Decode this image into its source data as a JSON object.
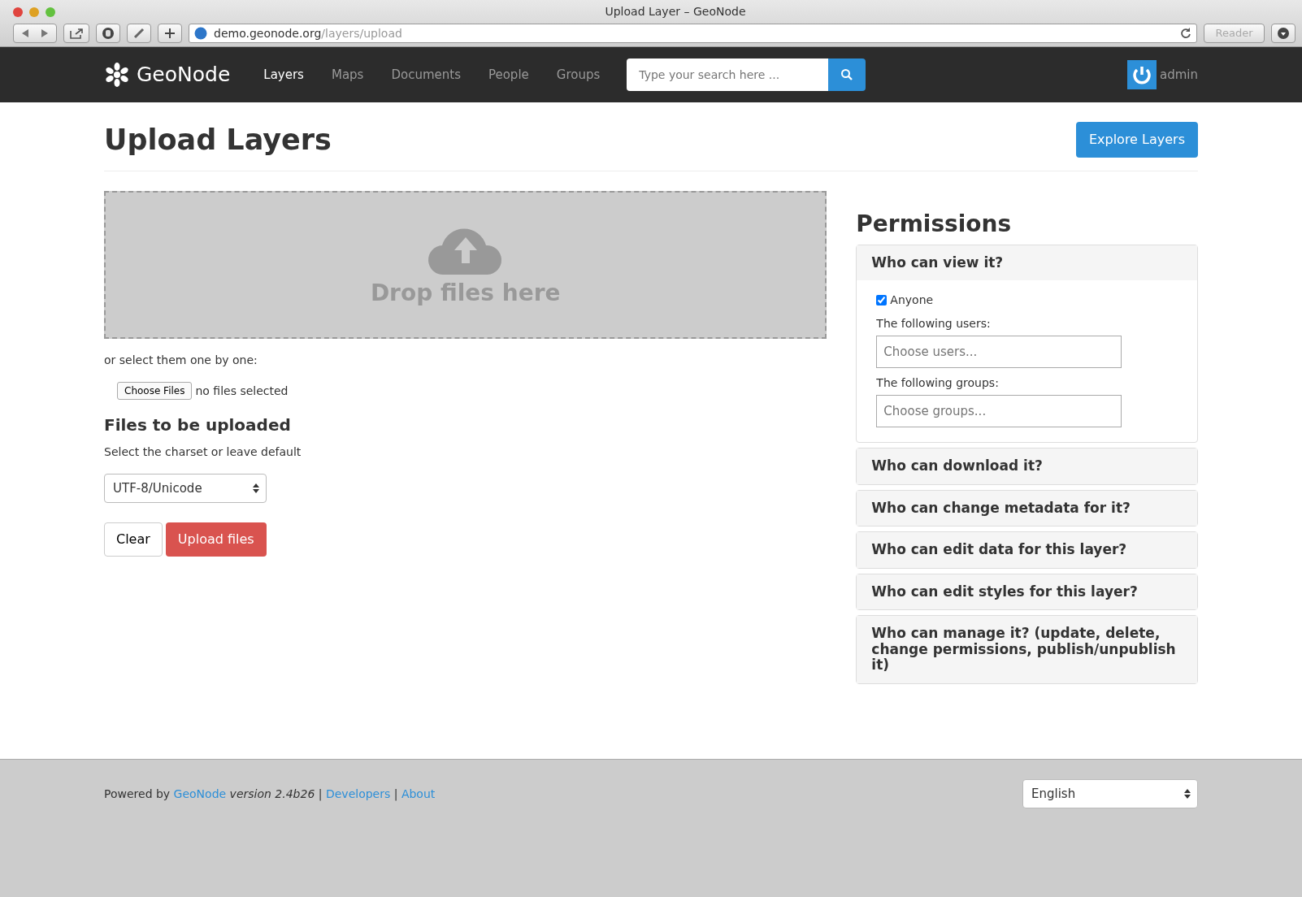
{
  "window": {
    "title": "Upload Layer – GeoNode",
    "url_host": "demo.geonode.org",
    "url_path": "/layers/upload",
    "reader": "Reader"
  },
  "navbar": {
    "brand": "GeoNode",
    "items": [
      {
        "label": "Layers",
        "selected": true
      },
      {
        "label": "Maps",
        "selected": false
      },
      {
        "label": "Documents",
        "selected": false
      },
      {
        "label": "People",
        "selected": false
      },
      {
        "label": "Groups",
        "selected": false
      }
    ],
    "search": {
      "placeholder": "Type your search here ..."
    },
    "user": "admin"
  },
  "page": {
    "title": "Upload Layers",
    "explore_button": "Explore Layers"
  },
  "upload": {
    "drop_text": "Drop files here",
    "select_hint": "or select them one by one:",
    "choose_button": "Choose Files",
    "file_status": "no files selected",
    "files_heading": "Files to be uploaded",
    "charset_hint": "Select the charset or leave default",
    "charset": "UTF-8/Unicode",
    "clear_button": "Clear",
    "upload_button": "Upload files"
  },
  "permissions": {
    "title": "Permissions",
    "panels": [
      {
        "title": "Who can view it?",
        "expanded": true,
        "anyone": {
          "label": "Anyone",
          "checked": true
        },
        "users": {
          "label": "The following users:",
          "placeholder": "Choose users..."
        },
        "groups": {
          "label": "The following groups:",
          "placeholder": "Choose groups..."
        }
      },
      {
        "title": "Who can download it?",
        "expanded": false
      },
      {
        "title": "Who can change metadata for it?",
        "expanded": false
      },
      {
        "title": "Who can edit data for this layer?",
        "expanded": false
      },
      {
        "title": "Who can edit styles for this layer?",
        "expanded": false
      },
      {
        "title": "Who can manage it? (update, delete, change permissions, publish/unpublish it)",
        "expanded": false
      }
    ]
  },
  "footer": {
    "segments": [
      {
        "kind": "text",
        "text": "Powered by "
      },
      {
        "kind": "link",
        "text": "GeoNode"
      },
      {
        "kind": "italic",
        "text": " version 2.4b26"
      },
      {
        "kind": "text",
        "text": " | "
      },
      {
        "kind": "link",
        "text": "Developers"
      },
      {
        "kind": "text",
        "text": " | "
      },
      {
        "kind": "link",
        "text": "About"
      }
    ],
    "language": "English"
  }
}
